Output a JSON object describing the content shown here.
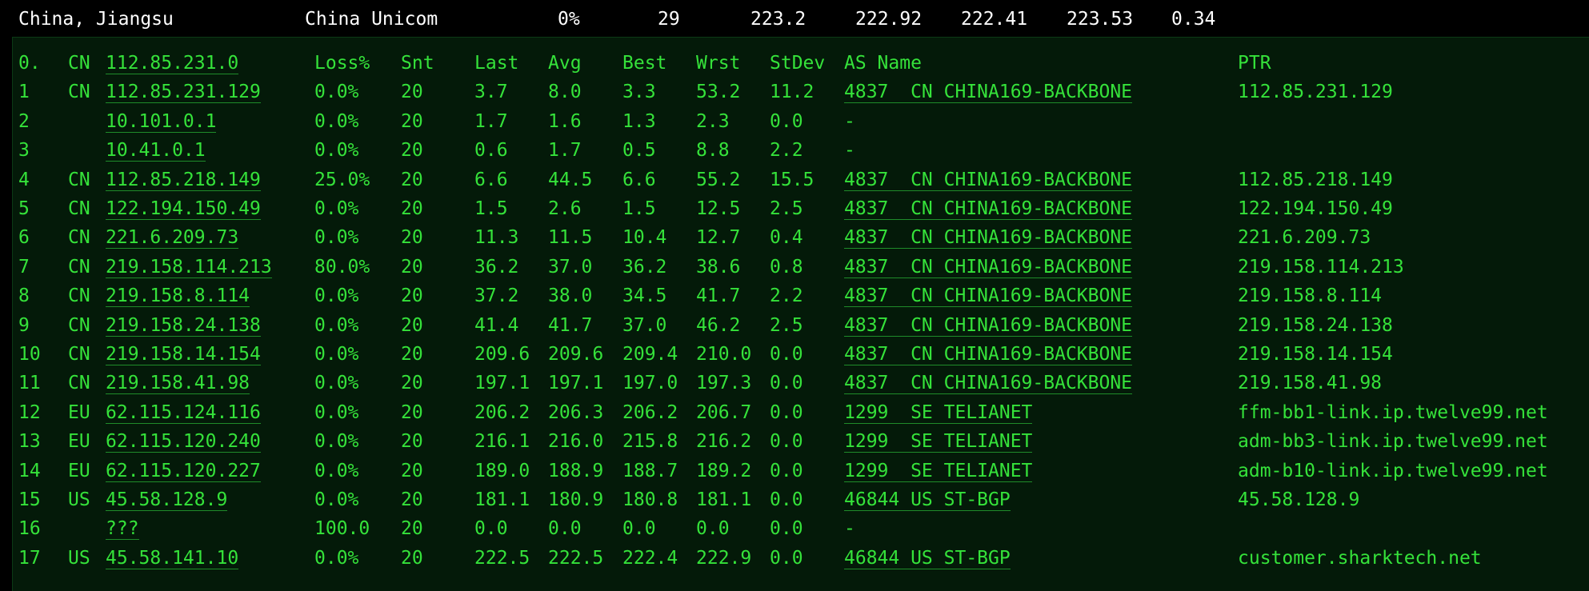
{
  "summary": {
    "location": "China, Jiangsu",
    "isp": "China Unicom",
    "loss": "0%",
    "count": "29",
    "last": "223.2",
    "avg": "222.92",
    "best": "222.41",
    "worst": "223.53",
    "stdev": "0.34"
  },
  "header": {
    "hop": "0.",
    "cc": "CN",
    "host": "112.85.231.0",
    "loss": "Loss%",
    "snt": "Snt",
    "last": "Last",
    "avg": "Avg",
    "best": "Best",
    "wrst": "Wrst",
    "stdev": "StDev",
    "asname": "AS Name",
    "ptr": "PTR"
  },
  "hops": [
    {
      "hop": "1",
      "cc": "CN",
      "host": "112.85.231.129",
      "loss": "0.0%",
      "snt": "20",
      "last": "3.7",
      "avg": "8.0",
      "best": "3.3",
      "wrst": "53.2",
      "stdev": "11.2",
      "as": "4837  CN CHINA169-BACKBONE",
      "ptr": "112.85.231.129"
    },
    {
      "hop": "2",
      "cc": "",
      "host": "10.101.0.1",
      "loss": "0.0%",
      "snt": "20",
      "last": "1.7",
      "avg": "1.6",
      "best": "1.3",
      "wrst": "2.3",
      "stdev": "0.0",
      "as": "-",
      "ptr": ""
    },
    {
      "hop": "3",
      "cc": "",
      "host": "10.41.0.1",
      "loss": "0.0%",
      "snt": "20",
      "last": "0.6",
      "avg": "1.7",
      "best": "0.5",
      "wrst": "8.8",
      "stdev": "2.2",
      "as": "-",
      "ptr": ""
    },
    {
      "hop": "4",
      "cc": "CN",
      "host": "112.85.218.149",
      "loss": "25.0%",
      "snt": "20",
      "last": "6.6",
      "avg": "44.5",
      "best": "6.6",
      "wrst": "55.2",
      "stdev": "15.5",
      "as": "4837  CN CHINA169-BACKBONE",
      "ptr": "112.85.218.149"
    },
    {
      "hop": "5",
      "cc": "CN",
      "host": "122.194.150.49",
      "loss": "0.0%",
      "snt": "20",
      "last": "1.5",
      "avg": "2.6",
      "best": "1.5",
      "wrst": "12.5",
      "stdev": "2.5",
      "as": "4837  CN CHINA169-BACKBONE",
      "ptr": "122.194.150.49"
    },
    {
      "hop": "6",
      "cc": "CN",
      "host": "221.6.209.73",
      "loss": "0.0%",
      "snt": "20",
      "last": "11.3",
      "avg": "11.5",
      "best": "10.4",
      "wrst": "12.7",
      "stdev": "0.4",
      "as": "4837  CN CHINA169-BACKBONE",
      "ptr": "221.6.209.73"
    },
    {
      "hop": "7",
      "cc": "CN",
      "host": "219.158.114.213",
      "loss": "80.0%",
      "snt": "20",
      "last": "36.2",
      "avg": "37.0",
      "best": "36.2",
      "wrst": "38.6",
      "stdev": "0.8",
      "as": "4837  CN CHINA169-BACKBONE",
      "ptr": "219.158.114.213"
    },
    {
      "hop": "8",
      "cc": "CN",
      "host": "219.158.8.114",
      "loss": "0.0%",
      "snt": "20",
      "last": "37.2",
      "avg": "38.0",
      "best": "34.5",
      "wrst": "41.7",
      "stdev": "2.2",
      "as": "4837  CN CHINA169-BACKBONE",
      "ptr": "219.158.8.114"
    },
    {
      "hop": "9",
      "cc": "CN",
      "host": "219.158.24.138",
      "loss": "0.0%",
      "snt": "20",
      "last": "41.4",
      "avg": "41.7",
      "best": "37.0",
      "wrst": "46.2",
      "stdev": "2.5",
      "as": "4837  CN CHINA169-BACKBONE",
      "ptr": "219.158.24.138"
    },
    {
      "hop": "10",
      "cc": "CN",
      "host": "219.158.14.154",
      "loss": "0.0%",
      "snt": "20",
      "last": "209.6",
      "avg": "209.6",
      "best": "209.4",
      "wrst": "210.0",
      "stdev": "0.0",
      "as": "4837  CN CHINA169-BACKBONE",
      "ptr": "219.158.14.154"
    },
    {
      "hop": "11",
      "cc": "CN",
      "host": "219.158.41.98",
      "loss": "0.0%",
      "snt": "20",
      "last": "197.1",
      "avg": "197.1",
      "best": "197.0",
      "wrst": "197.3",
      "stdev": "0.0",
      "as": "4837  CN CHINA169-BACKBONE",
      "ptr": "219.158.41.98"
    },
    {
      "hop": "12",
      "cc": "EU",
      "host": "62.115.124.116",
      "loss": "0.0%",
      "snt": "20",
      "last": "206.2",
      "avg": "206.3",
      "best": "206.2",
      "wrst": "206.7",
      "stdev": "0.0",
      "as": "1299  SE TELIANET",
      "ptr": "ffm-bb1-link.ip.twelve99.net"
    },
    {
      "hop": "13",
      "cc": "EU",
      "host": "62.115.120.240",
      "loss": "0.0%",
      "snt": "20",
      "last": "216.1",
      "avg": "216.0",
      "best": "215.8",
      "wrst": "216.2",
      "stdev": "0.0",
      "as": "1299  SE TELIANET",
      "ptr": "adm-bb3-link.ip.twelve99.net"
    },
    {
      "hop": "14",
      "cc": "EU",
      "host": "62.115.120.227",
      "loss": "0.0%",
      "snt": "20",
      "last": "189.0",
      "avg": "188.9",
      "best": "188.7",
      "wrst": "189.2",
      "stdev": "0.0",
      "as": "1299  SE TELIANET",
      "ptr": "adm-b10-link.ip.twelve99.net"
    },
    {
      "hop": "15",
      "cc": "US",
      "host": "45.58.128.9",
      "loss": "0.0%",
      "snt": "20",
      "last": "181.1",
      "avg": "180.9",
      "best": "180.8",
      "wrst": "181.1",
      "stdev": "0.0",
      "as": "46844 US ST-BGP",
      "ptr": "45.58.128.9"
    },
    {
      "hop": "16",
      "cc": "",
      "host": "???",
      "loss": "100.0",
      "snt": "20",
      "last": "0.0",
      "avg": "0.0",
      "best": "0.0",
      "wrst": "0.0",
      "stdev": "0.0",
      "as": "-",
      "ptr": ""
    },
    {
      "hop": "17",
      "cc": "US",
      "host": "45.58.141.10",
      "loss": "0.0%",
      "snt": "20",
      "last": "222.5",
      "avg": "222.5",
      "best": "222.4",
      "wrst": "222.9",
      "stdev": "0.0",
      "as": "46844 US ST-BGP",
      "ptr": "customer.sharktech.net"
    }
  ]
}
